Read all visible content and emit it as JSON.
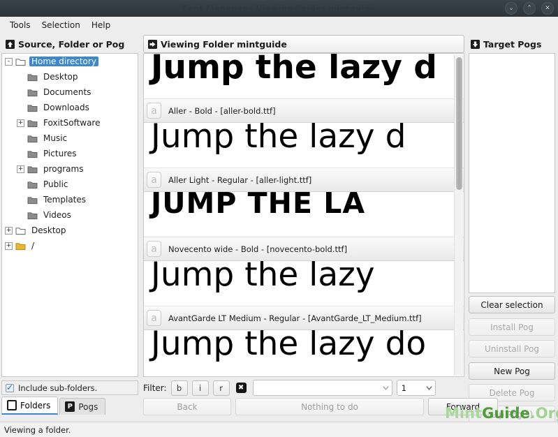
{
  "window": {
    "title": "Font Manager - Viewing Folder mintguide",
    "controls": [
      {
        "name": "minimize-button",
        "glyph": "⌄"
      },
      {
        "name": "maximize-button",
        "glyph": "⌃"
      },
      {
        "name": "close-button",
        "glyph": "✕"
      }
    ]
  },
  "menubar": {
    "items": [
      "Tools",
      "Selection",
      "Help"
    ]
  },
  "panels": {
    "source_header": "Source, Folder or Pog",
    "center_header": "Viewing Folder mintguide",
    "target_header": "Target Pogs"
  },
  "tree": {
    "items": [
      {
        "label": "Home directory",
        "depth": 0,
        "expander": "-",
        "selected": true,
        "folder": "open"
      },
      {
        "label": "Desktop",
        "depth": 1,
        "expander": "",
        "selected": false,
        "folder": "closed"
      },
      {
        "label": "Documents",
        "depth": 1,
        "expander": "",
        "selected": false,
        "folder": "closed"
      },
      {
        "label": "Downloads",
        "depth": 1,
        "expander": "",
        "selected": false,
        "folder": "closed"
      },
      {
        "label": "FoxitSoftware",
        "depth": 1,
        "expander": "+",
        "selected": false,
        "folder": "closed"
      },
      {
        "label": "Music",
        "depth": 1,
        "expander": "",
        "selected": false,
        "folder": "closed"
      },
      {
        "label": "Pictures",
        "depth": 1,
        "expander": "",
        "selected": false,
        "folder": "closed"
      },
      {
        "label": "programs",
        "depth": 1,
        "expander": "+",
        "selected": false,
        "folder": "closed"
      },
      {
        "label": "Public",
        "depth": 1,
        "expander": "",
        "selected": false,
        "folder": "closed"
      },
      {
        "label": "Templates",
        "depth": 1,
        "expander": "",
        "selected": false,
        "folder": "closed"
      },
      {
        "label": "Videos",
        "depth": 1,
        "expander": "",
        "selected": false,
        "folder": "closed"
      },
      {
        "label": "Desktop",
        "depth": 0,
        "expander": "+",
        "selected": false,
        "folder": "open"
      },
      {
        "label": "/",
        "depth": 0,
        "expander": "+",
        "selected": false,
        "folder": "yellow"
      }
    ]
  },
  "subfolders": {
    "label": "Include sub-folders.",
    "checked": true
  },
  "tabs": [
    {
      "label": "Folders",
      "active": true,
      "icon": "document-icon"
    },
    {
      "label": "Pogs",
      "active": false,
      "icon": "pog-icon"
    }
  ],
  "fonts": {
    "preview_text": "Jump the lazy dog",
    "preview_text_upper": "JUMP THE LAZY DOG",
    "badge_glyph": "a",
    "items": [
      {
        "family": "Aller",
        "style": "Bold",
        "file": "aller-bold.ttf",
        "meta": "Aller - Bold - [aller-bold.ttf]",
        "sample": "Jump the lazy d",
        "weight": "bold",
        "size": 47,
        "upper": false
      },
      {
        "family": "Aller Light",
        "style": "Regular",
        "file": "aller-light.ttf",
        "meta": "Aller Light - Regular - [aller-light.ttf]",
        "sample": "Jump the lazy d",
        "weight": "normal",
        "size": 47,
        "upper": false
      },
      {
        "family": "Novecento wide",
        "style": "Bold",
        "file": "novecento-bold.ttf",
        "meta": "Novecento wide - Bold - [novecento-bold.ttf]",
        "sample": "JUMP THE LA",
        "weight": "bold",
        "size": 41,
        "upper": true
      },
      {
        "family": "AvantGarde LT Medium",
        "style": "Regular",
        "file": "AvantGarde_LT_Medium.ttf",
        "meta": "AvantGarde LT Medium - Regular - [AvantGarde_LT_Medium.ttf]",
        "sample": "Jump the lazy",
        "weight": "normal",
        "size": 47,
        "upper": false
      },
      {
        "family": "",
        "style": "",
        "file": "",
        "meta": "",
        "sample": "Jump the lazy do",
        "weight": "normal",
        "size": 47,
        "upper": false
      }
    ]
  },
  "target_buttons": [
    {
      "label": "Clear selection",
      "enabled": true
    },
    {
      "label": "Install Pog",
      "enabled": false
    },
    {
      "label": "Uninstall Pog",
      "enabled": false
    },
    {
      "label": "New Pog",
      "enabled": true
    },
    {
      "label": "Delete Pog",
      "enabled": false
    },
    {
      "label": "Zip Pog(s)",
      "enabled": false
    }
  ],
  "filter": {
    "label": "Filter:",
    "buttons": [
      "b",
      "i",
      "r"
    ],
    "clear_icon": "✖",
    "text_value": "",
    "text_placeholder": "",
    "count_value": "1"
  },
  "nav": {
    "back_label": "Back",
    "back_enabled": false,
    "status_label": "Nothing to do",
    "status_enabled": false,
    "forward_label": "Forward",
    "forward_enabled": true
  },
  "statusbar": {
    "text": "Viewing a folder."
  },
  "watermark": {
    "part1": "Mint",
    "part2": "Guide",
    "part3": ".Org"
  },
  "colors": {
    "titlebar": "#333b42",
    "selection": "#3c87d0",
    "panel_bg": "#ededed",
    "watermark_green": "#4e9c3a"
  }
}
